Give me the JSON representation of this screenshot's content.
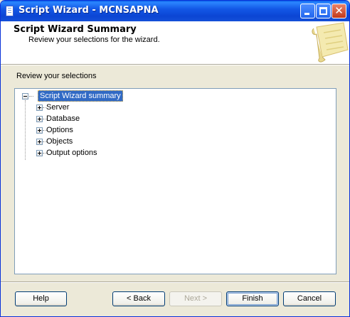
{
  "window": {
    "title": "Script Wizard - MCNSAPNA"
  },
  "header": {
    "title": "Script Wizard Summary",
    "subtitle": "Review your selections for the wizard."
  },
  "main": {
    "review_label": "Review your selections",
    "tree": {
      "root": {
        "label": "Script Wizard summary",
        "expanded": true,
        "selected": true
      },
      "children": [
        {
          "label": "Server",
          "expanded": false
        },
        {
          "label": "Database",
          "expanded": false
        },
        {
          "label": "Options",
          "expanded": false
        },
        {
          "label": "Objects",
          "expanded": false
        },
        {
          "label": "Output options",
          "expanded": false
        }
      ]
    }
  },
  "buttons": {
    "help": "Help",
    "back": "< Back",
    "next": "Next >",
    "finish": "Finish",
    "cancel": "Cancel"
  },
  "icons": {
    "title_icon": "document-icon",
    "header_icon": "scroll-icon"
  },
  "colors": {
    "titlebar": "#0b45d4",
    "selection": "#316ac5",
    "dialog_bg": "#ece9d8"
  }
}
